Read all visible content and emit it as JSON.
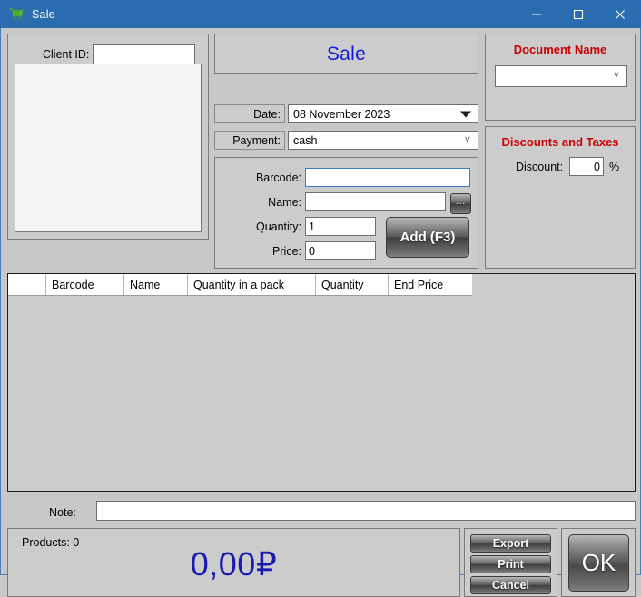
{
  "window": {
    "title": "Sale",
    "icon": "shopping-cart-icon",
    "minimize": "–",
    "maximize": "☐",
    "close": "✕",
    "titlebar_color": "#2a6cb0"
  },
  "left_panel": {
    "client_id_label": "Client ID:",
    "client_id_value": "",
    "client_id_placeholder": "",
    "client_list_items": []
  },
  "center": {
    "title": "Sale",
    "title_color": "#1018d8",
    "date_label": "Date:",
    "date_value": "08 November 2023",
    "payment_label": "Payment:",
    "payment_value": "cash",
    "payment_options": [
      "cash"
    ],
    "entry": {
      "barcode_label": "Barcode:",
      "barcode_value": "",
      "name_label": "Name:",
      "name_value": "",
      "browse_button": "...",
      "quantity_label": "Quantity:",
      "quantity_value": "1",
      "price_label": "Price:",
      "price_value": "0",
      "add_button": "Add (F3)"
    }
  },
  "right": {
    "document_name_header": "Document Name",
    "document_name_value": "",
    "document_name_options": [],
    "discounts_header": "Discounts and Taxes",
    "discount_label": "Discount:",
    "discount_value": "0",
    "percent_sign": "%",
    "header_color": "#cc0000"
  },
  "table": {
    "columns": [
      "",
      "Barcode",
      "Name",
      "Quantity in a pack",
      "Quantity",
      "End Price"
    ],
    "rows": []
  },
  "note": {
    "label": "Note:",
    "value": "",
    "placeholder": ""
  },
  "bottom": {
    "products_label": "Products:  0",
    "total": "0,00₽",
    "total_color": "#1a1ab0",
    "export_button": "Export",
    "print_button": "Print",
    "cancel_button": "Cancel",
    "ok_button": "OK"
  }
}
